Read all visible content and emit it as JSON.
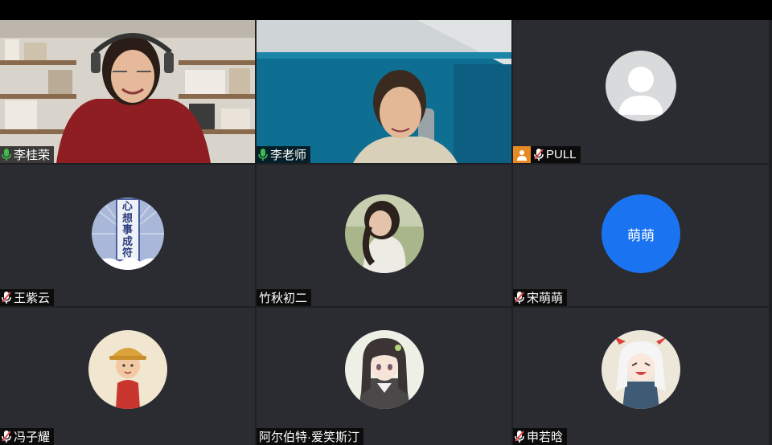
{
  "participants": [
    {
      "name": "李桂荣",
      "mic": "on"
    },
    {
      "name": "李老师",
      "mic": "on"
    },
    {
      "name": "PULL",
      "mic": "muted",
      "role_badge": "host-icon",
      "avatar": "default-person-avatar"
    },
    {
      "name": "王紫云",
      "mic": "muted",
      "avatar": "心想事成符"
    },
    {
      "name": "竹秋初二",
      "mic": "none",
      "avatar": "girl-photo-avatar"
    },
    {
      "name": "宋萌萌",
      "mic": "muted",
      "avatar_text": "萌萌"
    },
    {
      "name": "冯子耀",
      "mic": "muted",
      "avatar": "cartoon-boy-avatar"
    },
    {
      "name": "阿尔伯特·爱笑斯汀",
      "mic": "none",
      "avatar": "anime-girl-avatar"
    },
    {
      "name": "申若晗",
      "mic": "muted",
      "avatar": "chibi-character-avatar"
    }
  ],
  "avatar_text": {
    "ziyun_lines": [
      "心",
      "想",
      "事",
      "成",
      "符"
    ]
  },
  "colors": {
    "mic_on": "#3fb950",
    "mic_muted": "#e5484d",
    "host_badge": "#e88a22",
    "avatar_blue": "#1a73f0",
    "tile_bg": "#2b2c31",
    "speaking_border": "#3aa655"
  }
}
